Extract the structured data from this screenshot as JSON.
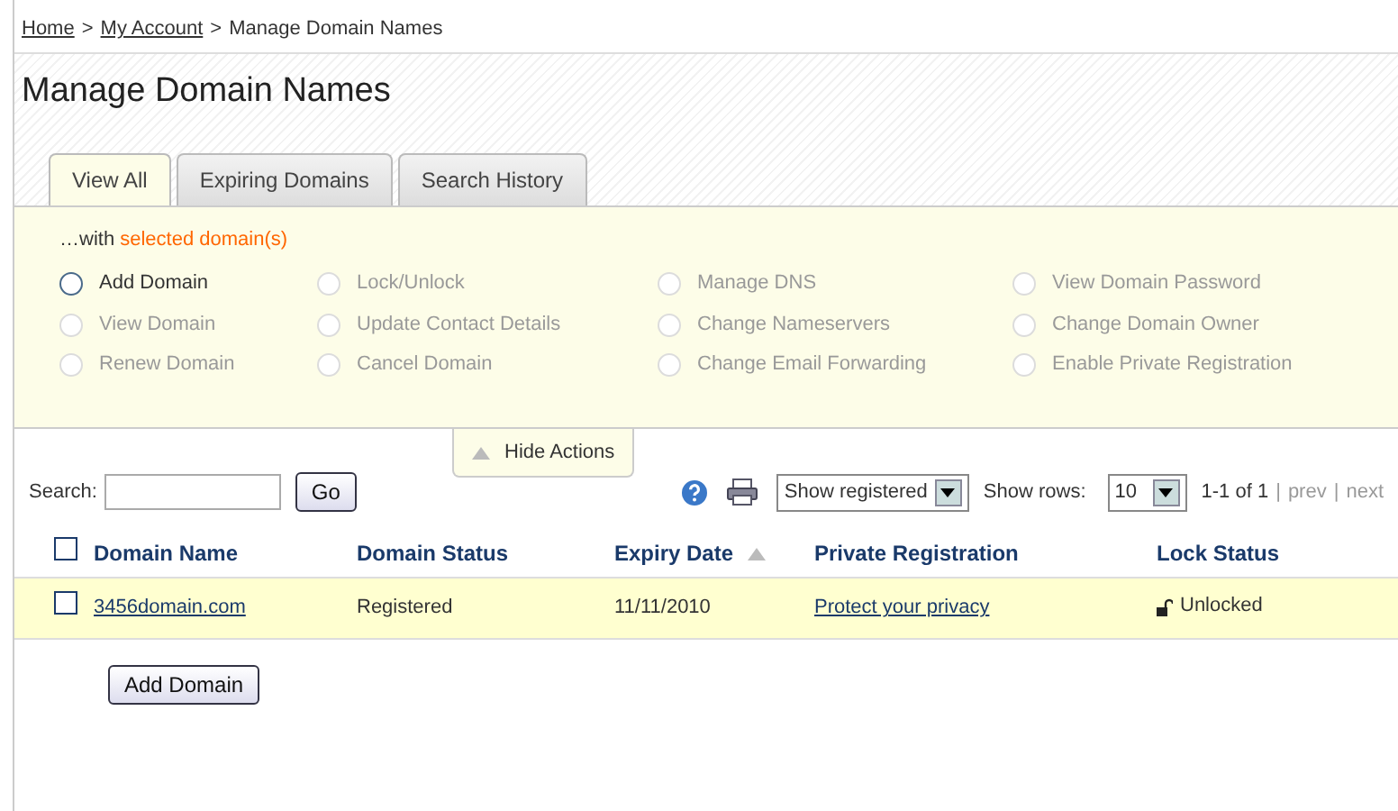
{
  "breadcrumb": [
    {
      "label": "Home",
      "link": true
    },
    {
      "label": "My Account",
      "link": true
    },
    {
      "label": "Manage Domain Names",
      "link": false
    }
  ],
  "breadcrumb_separators": [
    ">",
    ">"
  ],
  "title": "Manage Domain Names",
  "tabs": [
    {
      "label": "View All",
      "selected": true
    },
    {
      "label": "Expiring Domains",
      "selected": false
    },
    {
      "label": "Search History",
      "selected": false
    }
  ],
  "actions": {
    "intro": "…with",
    "intro_highlight": "selected domain(s)",
    "columns": [
      [
        {
          "label": "Add Domain",
          "disabled": false
        },
        {
          "label": "View Domain",
          "disabled": true
        },
        {
          "label": "Renew Domain",
          "disabled": true
        }
      ],
      [
        {
          "label": "Lock/Unlock",
          "disabled": true
        },
        {
          "label": "Update Contact Details",
          "disabled": true
        },
        {
          "label": "Cancel Domain",
          "disabled": true
        }
      ],
      [
        {
          "label": "Manage DNS",
          "disabled": true
        },
        {
          "label": "Change Nameservers",
          "disabled": true
        },
        {
          "label": "Change Email Forwarding",
          "disabled": true
        }
      ],
      [
        {
          "label": "View Domain Password",
          "disabled": true
        },
        {
          "label": "Change Domain Owner",
          "disabled": true
        },
        {
          "label": "Enable Private Registration",
          "disabled": true
        }
      ]
    ],
    "toggle": "Hide Actions"
  },
  "toolbar": {
    "search_label": "Search:",
    "go": "Go",
    "filter": "Show registered",
    "rows_label": "Show rows:",
    "rows": "10",
    "range": "1-1 of 1",
    "prev": "prev",
    "pager_separators": [
      "|",
      "|"
    ],
    "next": "next"
  },
  "table": {
    "columns": [
      {
        "label": "Domain Name",
        "sorted": false
      },
      {
        "label": "Domain Status",
        "sorted": false
      },
      {
        "label": "Expiry Date",
        "sorted": true
      },
      {
        "label": "Private Registration",
        "sorted": false
      },
      {
        "label": "Lock Status",
        "sorted": false
      }
    ],
    "select_all": false,
    "rows": [
      {
        "checked": false,
        "domain": "3456domain.com",
        "status": "Registered",
        "expiry": "11/11/2010",
        "privacy": "Protect your privacy",
        "lock": "Unlocked"
      }
    ]
  },
  "add_button": "Add Domain"
}
